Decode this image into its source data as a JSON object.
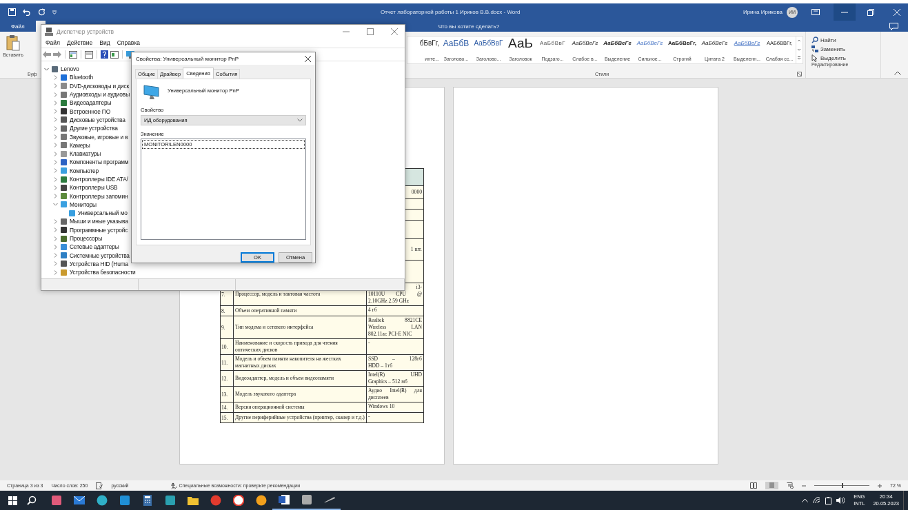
{
  "word": {
    "title": "Отчет лабораторной работы 1 Ириков В.В.docx  -  Word",
    "user": "Ирина Ирикова",
    "avatar": "ИИ",
    "file_tab": "Файл",
    "tell_me": "Что вы хотите сделать?",
    "paste": "Вставить",
    "clipboard_group": "Буф",
    "styles": [
      {
        "preview": "бБвГг,",
        "label": "инте...",
        "kind": "normal"
      },
      {
        "preview": "АаБбВ",
        "label": "Заголово...",
        "kind": "heading"
      },
      {
        "preview": "АаБбВвГ",
        "label": "Заголово...",
        "kind": "heading2"
      },
      {
        "preview": "АаЬ",
        "label": "Заголовок",
        "kind": "title"
      },
      {
        "preview": "АаБбВвГ",
        "label": "Подзаго...",
        "kind": "subtitle"
      },
      {
        "preview": "АаБбВеГг",
        "label": "Слабое в...",
        "kind": "italic"
      },
      {
        "preview": "АаБбВеГг",
        "label": "Выделение",
        "kind": "bolditalic"
      },
      {
        "preview": "АаБбВеГг",
        "label": "Сильное...",
        "kind": "blueitalic"
      },
      {
        "preview": "АаБбВвГг,",
        "label": "Строгий",
        "kind": "bold"
      },
      {
        "preview": "АаБбВеГг",
        "label": "Цитата 2",
        "kind": "italic"
      },
      {
        "preview": "АаБбВеГг",
        "label": "Выделенн...",
        "kind": "blueunderline"
      },
      {
        "preview": "ААБбВВГг,",
        "label": "Слабая сс...",
        "kind": "caps"
      }
    ],
    "styles_group": "Стили",
    "editing": [
      {
        "label": "Найти",
        "kind": "find"
      },
      {
        "label": "Заменить",
        "kind": "replace"
      },
      {
        "label": "Выделить",
        "kind": "select"
      }
    ],
    "editing_group": "Редактирование",
    "table": {
      "rows": [
        {
          "kind": "header"
        },
        {
          "kind": "hidden",
          "cut_value": "0000"
        },
        {
          "kind": "hidden"
        },
        {
          "kind": "hidden"
        },
        {
          "kind": "hidden"
        },
        {
          "kind": "hidden",
          "cut_value": "1 шт."
        },
        {
          "kind": "hidden"
        },
        {
          "kind": "data",
          "number": "7.",
          "name": "Процессор, модель и тактовая частота",
          "cut_value": "i3-",
          "value": [
            "10110U CPU @",
            "2.10GHz 2.59 GHz"
          ]
        },
        {
          "kind": "data",
          "number": "8.",
          "name": "Объем оперативной памяти",
          "value": [
            "4 гб"
          ]
        },
        {
          "kind": "data",
          "number": "9.",
          "name": "Тип модема и сетевого интерфейса",
          "value": [
            "Realtek 8821CE",
            "Wireless LAN",
            "802.11ac PCI-E NIC"
          ]
        },
        {
          "kind": "data",
          "number": "10.",
          "name": "Наименование и скорость привода для чтения оптических дисков",
          "value": [
            "-"
          ]
        },
        {
          "kind": "data",
          "number": "11.",
          "name": "Модель и объем памяти накопителя на жестких магнитных дисках",
          "value": [
            "SSD – 128гб",
            "HDD – 1тб"
          ]
        },
        {
          "kind": "data",
          "number": "12.",
          "name": "Видеоадаптер, модель и объем видеопамяти",
          "value": [
            "Intel(R) UHD",
            "Graphics – 512 мб"
          ]
        },
        {
          "kind": "data",
          "number": "13.",
          "name": "Модель звукового адаптера",
          "value": [
            "Аудио Intel(R) для",
            "дисплеев"
          ]
        },
        {
          "kind": "data",
          "number": "14.",
          "name": "Версия операционной системы",
          "value": [
            "Windows 10"
          ]
        },
        {
          "kind": "data",
          "number": "15.",
          "name": "Другие периферийные устройства (принтер, сканер и т.д.)",
          "value": [
            "-"
          ]
        }
      ]
    },
    "status": {
      "page": "Страница 3 из 3",
      "words": "Число слов: 250",
      "language": "русский",
      "accessibility": "Специальные возможности: проверьте рекомендации",
      "zoom": "72 %",
      "level": 0.5
    }
  },
  "device_manager": {
    "title": "Диспетчер устройств",
    "menu": [
      "Файл",
      "Действие",
      "Вид",
      "Справка"
    ],
    "tree": {
      "label": "Lenovo",
      "kind": "computer",
      "expanded": true,
      "children": [
        {
          "label": "Bluetooth",
          "kind": "bluetooth",
          "expanded": false
        },
        {
          "label": "DVD-дисководы и диск",
          "kind": "dvd",
          "expanded": false
        },
        {
          "label": "Аудиовходы и аудиовы",
          "kind": "speaker",
          "expanded": false
        },
        {
          "label": "Видеоадаптеры",
          "kind": "card",
          "expanded": false
        },
        {
          "label": "Встроенное ПО",
          "kind": "chip",
          "expanded": false
        },
        {
          "label": "Дисковые устройства",
          "kind": "drive",
          "expanded": false
        },
        {
          "label": "Другие устройства",
          "kind": "unknown",
          "expanded": false
        },
        {
          "label": "Звуковые, игровые и в",
          "kind": "speaker",
          "expanded": false
        },
        {
          "label": "Камеры",
          "kind": "camera",
          "expanded": false
        },
        {
          "label": "Клавиатуры",
          "kind": "keyboard",
          "expanded": false
        },
        {
          "label": "Компоненты программ",
          "kind": "component",
          "expanded": false
        },
        {
          "label": "Компьютер",
          "kind": "monitor",
          "expanded": false
        },
        {
          "label": "Контроллеры IDE ATA/",
          "kind": "card",
          "expanded": false
        },
        {
          "label": "Контроллеры USB",
          "kind": "usb",
          "expanded": false
        },
        {
          "label": "Контроллеры запомин",
          "kind": "storage",
          "expanded": false
        },
        {
          "label": "Мониторы",
          "kind": "monitor",
          "expanded": true,
          "children": [
            {
              "label": "Универсальный мо",
              "kind": "monitor"
            }
          ]
        },
        {
          "label": "Мыши и иные указыва",
          "kind": "mouse",
          "expanded": false
        },
        {
          "label": "Программные устройс",
          "kind": "chip",
          "expanded": false
        },
        {
          "label": "Процессоры",
          "kind": "cpu",
          "expanded": false
        },
        {
          "label": "Сетевые адаптеры",
          "kind": "network",
          "expanded": false
        },
        {
          "label": "Системные устройства",
          "kind": "system",
          "expanded": false
        },
        {
          "label": "Устройства HID (Huma",
          "kind": "hid",
          "expanded": false
        },
        {
          "label": "Устройства безопасности",
          "kind": "security",
          "expanded": false
        }
      ]
    }
  },
  "dialog": {
    "title": "Свойства: Универсальный монитор PnP",
    "tabs": [
      {
        "label": "Общие",
        "selected": false
      },
      {
        "label": "Драйвер",
        "selected": false
      },
      {
        "label": "Сведения",
        "selected": true
      },
      {
        "label": "События",
        "selected": false
      }
    ],
    "device": "Универсальный монитор PnP",
    "property_label": "Свойство",
    "property": "ИД оборудования",
    "value_label": "Значение",
    "values": [
      {
        "text": "MONITOR\\LEN0000",
        "selected": true
      }
    ],
    "buttons": [
      {
        "label": "OK",
        "default": true
      },
      {
        "label": "Отмена",
        "default": false
      }
    ]
  },
  "taskbar": {
    "apps": [
      {
        "kind": "paint"
      },
      {
        "kind": "mail"
      },
      {
        "kind": "browser"
      },
      {
        "kind": "tile"
      },
      {
        "kind": "calculator"
      },
      {
        "kind": "photos"
      },
      {
        "kind": "folder"
      },
      {
        "kind": "red"
      },
      {
        "kind": "yandex"
      },
      {
        "kind": "orange"
      },
      {
        "kind": "word"
      },
      {
        "kind": "drive"
      },
      {
        "kind": "pen"
      }
    ],
    "lang": "ENG",
    "layout": "INTL",
    "time": "20:34",
    "date": "20.05.2023"
  }
}
